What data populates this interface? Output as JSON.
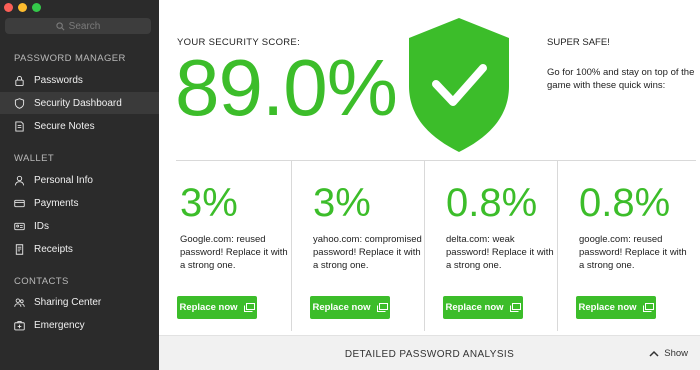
{
  "window": {
    "traffic_lights": [
      "#fc5f57",
      "#fdbc2e",
      "#34c84a"
    ]
  },
  "search": {
    "placeholder": "Search",
    "icon": "search-icon"
  },
  "sidebar": {
    "sections": [
      {
        "title": "PASSWORD MANAGER",
        "items": [
          {
            "label": "Passwords",
            "icon": "lock-icon",
            "active": false
          },
          {
            "label": "Security Dashboard",
            "icon": "shield-icon",
            "active": true
          },
          {
            "label": "Secure Notes",
            "icon": "note-icon",
            "active": false
          }
        ]
      },
      {
        "title": "WALLET",
        "items": [
          {
            "label": "Personal Info",
            "icon": "person-icon",
            "active": false
          },
          {
            "label": "Payments",
            "icon": "card-icon",
            "active": false
          },
          {
            "label": "IDs",
            "icon": "id-icon",
            "active": false
          },
          {
            "label": "Receipts",
            "icon": "receipt-icon",
            "active": false
          }
        ]
      },
      {
        "title": "CONTACTS",
        "items": [
          {
            "label": "Sharing Center",
            "icon": "people-icon",
            "active": false
          },
          {
            "label": "Emergency",
            "icon": "medical-icon",
            "active": false
          }
        ]
      }
    ]
  },
  "score": {
    "label": "YOUR SECURITY SCORE:",
    "value": "89.0%",
    "shield_color": "#3cbd2a",
    "status_title": "SUPER SAFE!",
    "status_text": "Go for 100% and stay on top of the game with these quick wins:"
  },
  "wins": [
    {
      "percent": "3%",
      "description": "Google.com: reused password! Replace it with a strong one.",
      "button": "Replace now"
    },
    {
      "percent": "3%",
      "description": "yahoo.com: compromised password! Replace it with a strong one.",
      "button": "Replace now"
    },
    {
      "percent": "0.8%",
      "description": "delta.com: weak password! Replace it with a strong one.",
      "button": "Replace now"
    },
    {
      "percent": "0.8%",
      "description": "google.com: reused password! Replace it with a strong one.",
      "button": "Replace now"
    }
  ],
  "footer": {
    "title": "DETAILED PASSWORD ANALYSIS",
    "toggle_label": "Show"
  },
  "colors": {
    "accent": "#3cbd2a",
    "sidebar_bg": "#2b2b2b"
  }
}
